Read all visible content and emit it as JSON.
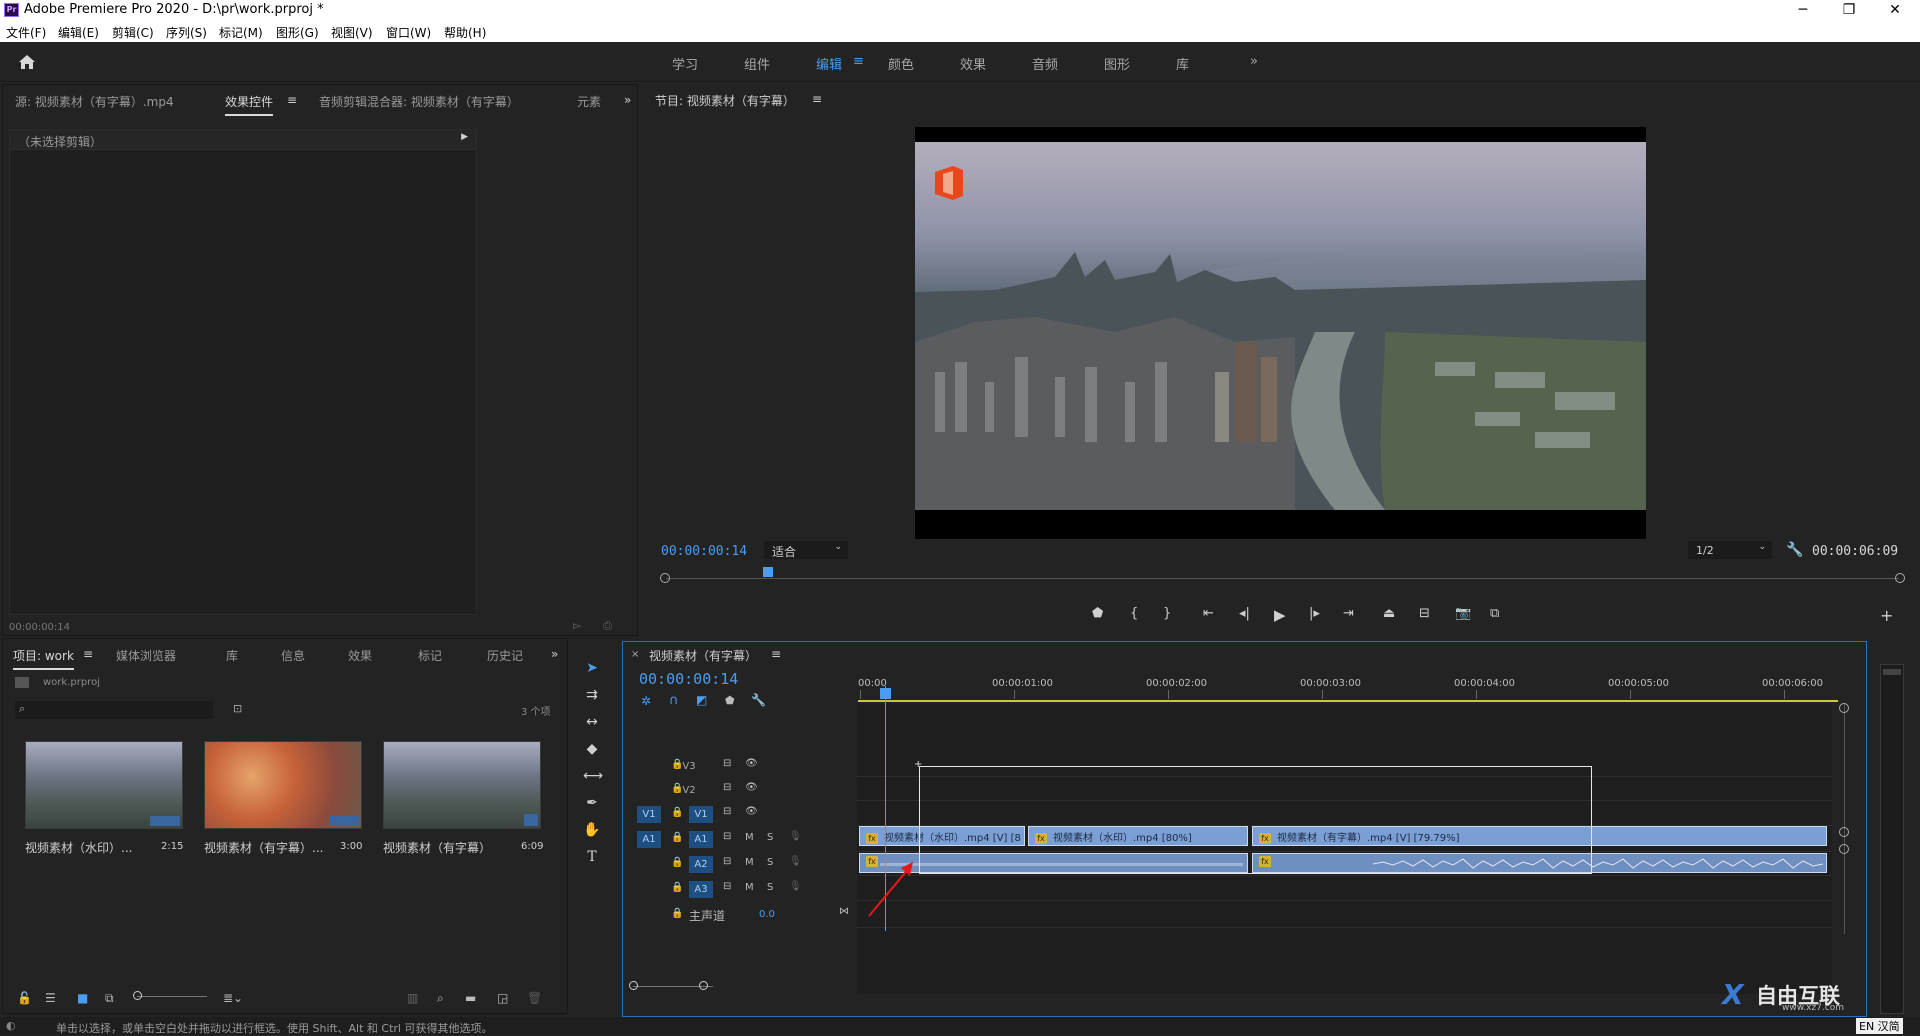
{
  "window": {
    "title": "Adobe Premiere Pro 2020 - D:\\pr\\work.prproj *",
    "app_icon": "Pr",
    "controls": [
      "─",
      "❐",
      "✕"
    ]
  },
  "menu": [
    "文件(F)",
    "编辑(E)",
    "剪辑(C)",
    "序列(S)",
    "标记(M)",
    "图形(G)",
    "视图(V)",
    "窗口(W)",
    "帮助(H)"
  ],
  "workspaces": {
    "items": [
      "学习",
      "组件",
      "编辑",
      "颜色",
      "效果",
      "音频",
      "图形",
      "库"
    ],
    "active": "编辑",
    "more": "»"
  },
  "source_panel": {
    "tabs": [
      "源: 视频素材（有字幕）.mp4",
      "效果控件",
      "音频剪辑混合器: 视频素材（有字幕）",
      "元素"
    ],
    "active_tab": "效果控件",
    "no_clip": "（未选择剪辑）",
    "timecode": "00:00:00:14",
    "more": "»"
  },
  "program_panel": {
    "title": "节目: 视频素材（有字幕）",
    "timecode": "00:00:00:14",
    "fit": "适合",
    "resolution": "1/2",
    "duration": "00:00:06:09",
    "playhead_fraction": 0.083
  },
  "project_panel": {
    "tabs": [
      "项目: work",
      "媒体浏览器",
      "库",
      "信息",
      "效果",
      "标记",
      "历史记"
    ],
    "active_tab": "项目: work",
    "project_file": "work.prproj",
    "item_count": "3 个项",
    "more": "»",
    "items": [
      {
        "name": "视频素材（水印）...",
        "duration": "2:15",
        "kind": "city"
      },
      {
        "name": "视频素材（有字幕）...",
        "duration": "3:00",
        "kind": "leaves"
      },
      {
        "name": "视频素材（有字幕）",
        "duration": "6:09",
        "kind": "city"
      }
    ]
  },
  "timeline": {
    "sequence_name": "视频素材（有字幕）",
    "timecode": "00:00:00:14",
    "ruler": [
      "00:00",
      "00:00:01:00",
      "00:00:02:00",
      "00:00:03:00",
      "00:00:04:00",
      "00:00:05:00",
      "00:00:06:00"
    ],
    "tracks": [
      {
        "id": "V3",
        "target": "",
        "kind": "video"
      },
      {
        "id": "V2",
        "target": "",
        "kind": "video"
      },
      {
        "id": "V1",
        "target": "V1",
        "kind": "video"
      },
      {
        "id": "A1",
        "target": "A1",
        "kind": "audio"
      },
      {
        "id": "A2",
        "target": "",
        "kind": "audio"
      },
      {
        "id": "A3",
        "target": "",
        "kind": "audio"
      }
    ],
    "master": {
      "label": "主声道",
      "value": "0.0"
    },
    "video_clips": [
      "视频素材（水印）.mp4 [V] [8",
      "视频素材（水印）.mp4 [80%]",
      "视频素材（有字幕）.mp4 [V] [79.79%]"
    ],
    "mute_label": "M",
    "solo_label": "S",
    "fx_label": "fx"
  },
  "status": {
    "hint": "单击以选择，或单击空白处并拖动以进行框选。使用 Shift、Alt 和 Ctrl 可获得其他选项。"
  },
  "watermark": {
    "text": "自由互联",
    "url": "www.xz7.com",
    "lang": "EN 汉简"
  },
  "colors": {
    "accent": "#4a9df1",
    "clip_video": "#7b9fd4",
    "clip_audio": "#6e8fbf",
    "marquee": "#e6e6e6",
    "arrow": "#e8171b"
  }
}
